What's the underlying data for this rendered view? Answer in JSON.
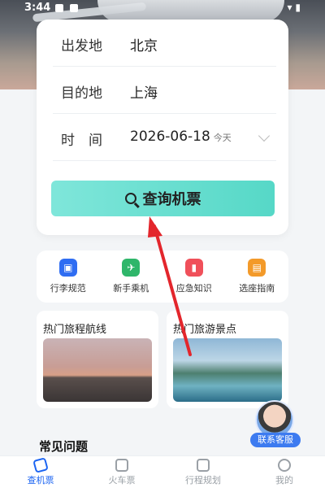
{
  "status": {
    "time": "3:44",
    "right": "▾ ▮"
  },
  "search": {
    "from_label": "出发地",
    "from_value": "北京",
    "to_label": "目的地",
    "to_value": "上海",
    "time_label": "时　间",
    "date_value": "2026-06-18",
    "today": "今天",
    "button": "查询机票"
  },
  "quick": [
    {
      "label": "行李规范",
      "icon": "luggage-icon",
      "color": "#2f6df2"
    },
    {
      "label": "新手乘机",
      "icon": "plane-icon",
      "color": "#2fb66a"
    },
    {
      "label": "应急知识",
      "icon": "emergency-icon",
      "color": "#f0505a"
    },
    {
      "label": "选座指南",
      "icon": "seat-icon",
      "color": "#f39a2a"
    }
  ],
  "cards": {
    "routes_title": "热门旅程航线",
    "spots_title": "热门旅游景点"
  },
  "faq": {
    "title": "常见问题"
  },
  "support": {
    "label": "联系客服"
  },
  "nav": [
    {
      "label": "查机票",
      "active": true
    },
    {
      "label": "火车票",
      "active": false
    },
    {
      "label": "行程规划",
      "active": false
    },
    {
      "label": "我的",
      "active": false
    }
  ],
  "colors": {
    "accent": "#56d8c7",
    "nav_active": "#1b64f2"
  }
}
